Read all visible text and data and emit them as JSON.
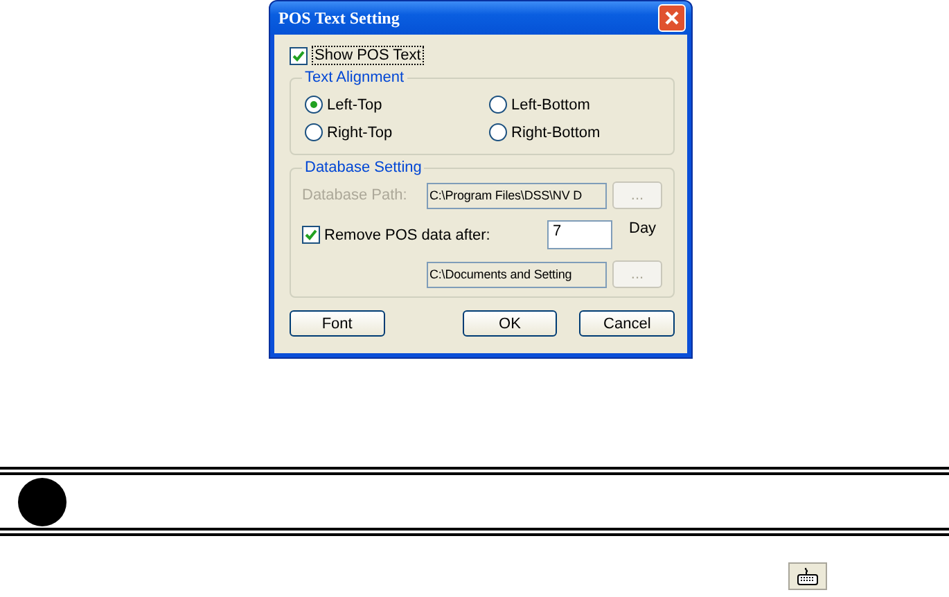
{
  "dialog": {
    "title": "POS Text Setting",
    "show_pos_text": {
      "label": "Show POS Text",
      "checked": true
    },
    "text_alignment": {
      "title": "Text Alignment",
      "options": [
        {
          "label": "Left-Top",
          "selected": true
        },
        {
          "label": "Left-Bottom",
          "selected": false
        },
        {
          "label": "Right-Top",
          "selected": false
        },
        {
          "label": "Right-Bottom",
          "selected": false
        }
      ]
    },
    "database_setting": {
      "title": "Database Setting",
      "database_path": {
        "label": "Database Path:",
        "disabled": true,
        "value": "C:\\Program Files\\DSS\\NV D",
        "browse": {
          "label": "...",
          "disabled": true
        }
      },
      "remove_after": {
        "label": "Remove POS data after:",
        "checked": true,
        "value": "7",
        "unit": "Day"
      },
      "backup_path": {
        "value": "C:\\Documents and Setting",
        "browse": {
          "label": "...",
          "disabled": true
        }
      }
    },
    "buttons": [
      {
        "label": "Font",
        "kind": "left"
      },
      {
        "label": "OK",
        "kind": "right"
      },
      {
        "label": "Cancel",
        "kind": "right"
      }
    ]
  }
}
